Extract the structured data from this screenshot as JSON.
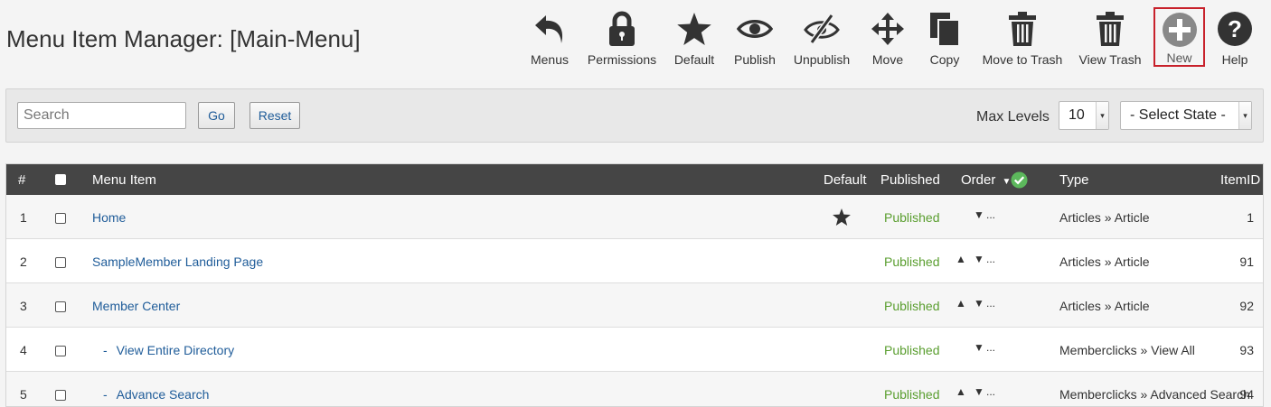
{
  "page": {
    "title": "Menu Item Manager: [Main-Menu]"
  },
  "toolbar": {
    "menus": "Menus",
    "permissions": "Permissions",
    "default": "Default",
    "publish": "Publish",
    "unpublish": "Unpublish",
    "move": "Move",
    "copy": "Copy",
    "move_to_trash": "Move to Trash",
    "view_trash": "View Trash",
    "new": "New",
    "help": "Help",
    "icons": [
      "undo-arrow-icon",
      "lock-icon",
      "star-icon",
      "eye-icon",
      "eye-slash-icon",
      "move-arrows-icon",
      "copy-icon",
      "trash-icon",
      "trash-icon",
      "plus-circle-icon",
      "question-circle-icon"
    ]
  },
  "filter": {
    "search_placeholder": "Search",
    "go_label": "Go",
    "reset_label": "Reset",
    "max_levels_label": "Max Levels",
    "max_levels_value": "10",
    "state_value": "- Select State -"
  },
  "table": {
    "headers": {
      "num": "#",
      "menu_item": "Menu Item",
      "default": "Default",
      "published": "Published",
      "order": "Order",
      "type": "Type",
      "itemid": "ItemID"
    },
    "rows": [
      {
        "num": "1",
        "dash": "",
        "title": "Home",
        "is_default": true,
        "published": "Published",
        "order_up": false,
        "order_down": true,
        "order_dots": "...",
        "type": "Articles » Article",
        "itemid": "1"
      },
      {
        "num": "2",
        "dash": "",
        "title": "SampleMember Landing Page",
        "is_default": false,
        "published": "Published",
        "order_up": true,
        "order_down": true,
        "order_dots": "...",
        "type": "Articles » Article",
        "itemid": "91"
      },
      {
        "num": "3",
        "dash": "",
        "title": "Member Center",
        "is_default": false,
        "published": "Published",
        "order_up": true,
        "order_down": true,
        "order_dots": "...",
        "type": "Articles » Article",
        "itemid": "92"
      },
      {
        "num": "4",
        "dash": "-",
        "title": "View Entire Directory",
        "is_default": false,
        "published": "Published",
        "order_up": false,
        "order_down": true,
        "order_dots": "...",
        "type": "Memberclicks » View All",
        "itemid": "93"
      },
      {
        "num": "5",
        "dash": "-",
        "title": "Advance Search",
        "is_default": false,
        "published": "Published",
        "order_up": true,
        "order_down": true,
        "order_dots": "...",
        "type": "Memberclicks » Advanced Search",
        "itemid": "94"
      }
    ]
  },
  "colors": {
    "header_bg": "#454545",
    "link": "#1f5c99",
    "published": "#5a9e2f",
    "check": "#5cb85c",
    "new_highlight": "#c8212b"
  }
}
